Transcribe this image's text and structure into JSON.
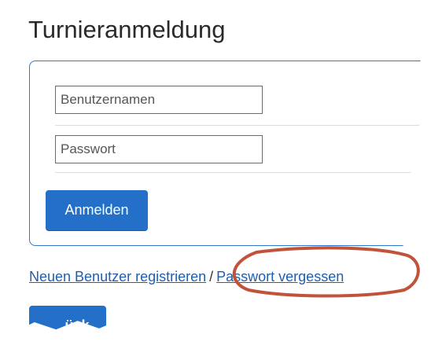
{
  "page": {
    "title": "Turnieranmeldung"
  },
  "login_form": {
    "username_placeholder": "Benutzernamen",
    "password_placeholder": "Passwort",
    "submit_label": "Anmelden"
  },
  "links": {
    "register_label": "Neuen Benutzer registrieren",
    "separator": "/",
    "forgot_password_label": "Passwort vergessen"
  },
  "back_button": {
    "label": "ück"
  },
  "annotation": {
    "highlight_color": "#c0533a",
    "target": "forgot-password-link"
  },
  "colors": {
    "accent": "#2470c8",
    "link": "#1f5fb0",
    "panel_border": "#2f78d0"
  }
}
